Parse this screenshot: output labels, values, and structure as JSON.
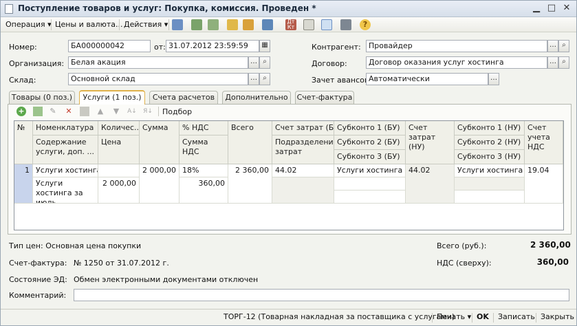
{
  "window": {
    "title": "Поступление товаров и услуг: Покупка, комиссия. Проведен *"
  },
  "toolbar": {
    "operation": "Операция ▾",
    "prices": "Цены и валюта...",
    "actions": "Действия ▾"
  },
  "header": {
    "number_label": "Номер:",
    "number": "БА000000042",
    "date_label": "от:",
    "date": "31.07.2012 23:59:59",
    "org_label": "Организация:",
    "org": "Белая акация",
    "warehouse_label": "Склад:",
    "warehouse": "Основной склад",
    "contractor_label": "Контрагент:",
    "contractor": "Провайдер",
    "contract_label": "Договор:",
    "contract": "Договор оказания услуг хостинга",
    "advance_label": "Зачет авансов:",
    "advance": "Автоматически"
  },
  "tabs": [
    "Товары (0 поз.)",
    "Услуги (1 поз.)",
    "Счета расчетов",
    "Дополнительно",
    "Счет-фактура"
  ],
  "grid_toolbar": {
    "select": "Подбор"
  },
  "columns": {
    "num": "№",
    "nomen": "Номенклатура",
    "content": "Содержание услуги, доп. ...",
    "qty": "Количес...",
    "price": "Цена",
    "sum": "Сумма",
    "vat_rate": "% НДС",
    "vat_sum": "Сумма НДС",
    "total": "Всего",
    "cost_acc": "Счет затрат (Б...",
    "division": "Подразделение затрат",
    "sub1": "Субконто 1 (БУ)",
    "sub2": "Субконто 2 (БУ)",
    "sub3": "Субконто 3 (БУ)",
    "cost_acc_nu": "Счет затрат (НУ)",
    "sub1nu": "Субконто 1 (НУ)",
    "sub2nu": "Субконто 2 (НУ)",
    "sub3nu": "Субконто 3 (НУ)",
    "vat_acc": "Счет учета НДС"
  },
  "row": {
    "num": "1",
    "nomen": "Услуги хостинга",
    "content": "Услуги хостинга за июль",
    "price": "2 000,00",
    "sum": "2 000,00",
    "vat_rate": "18%",
    "vat_sum": "360,00",
    "total": "2 360,00",
    "cost_acc": "44.02",
    "sub1": "Услуги хостинга",
    "cost_acc_nu": "44.02",
    "sub1nu": "Услуги хостинга",
    "vat_acc": "19.04"
  },
  "summary": {
    "price_type": "Тип цен: Основная цена покупки",
    "total_label": "Всего (руб.):",
    "total": "2 360,00",
    "invoice_label": "Счет-фактура:",
    "invoice": "№ 1250 от 31.07.2012 г.",
    "vat_label": "НДС (сверху):",
    "vat": "360,00",
    "edo_label": "Состояние ЭД:",
    "edo": "Обмен электронными документами отключен",
    "comment_label": "Комментарий:"
  },
  "footer": {
    "torg": "ТОРГ-12 (Товарная накладная за поставщика с услугами)",
    "print": "Печать ▾",
    "ok": "OK",
    "save": "Записать",
    "close": "Закрыть"
  },
  "colors": {
    "accent": "#e0b14a",
    "selected_row": "#c8d4ec"
  }
}
